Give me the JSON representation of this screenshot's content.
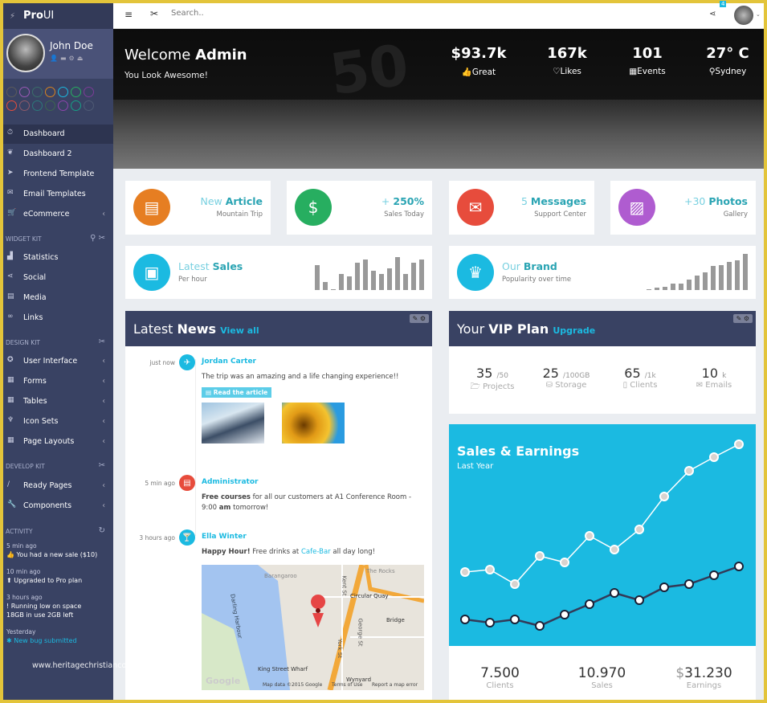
{
  "app": {
    "brand_bold": "Pro",
    "brand_light": "UI"
  },
  "user": {
    "name": "John Doe"
  },
  "theme_colors": [
    "#5b5b5b",
    "#9b59b6",
    "#3a6f6a",
    "#d9831f",
    "#1bbae1",
    "#27ae60",
    "#7d3c98",
    "#e74c3c",
    "#8e5a6a",
    "#2c7a7b",
    "#3d6650",
    "#8e44ad",
    "#16a085",
    "#4f5b75"
  ],
  "sidebar": {
    "main": [
      {
        "label": "Dashboard",
        "icon": "stopwatch-icon",
        "active": true
      },
      {
        "label": "Dashboard 2",
        "icon": "leaf-icon"
      },
      {
        "label": "Frontend Template",
        "icon": "send-icon"
      },
      {
        "label": "Email Templates",
        "icon": "envelope-icon"
      },
      {
        "label": "eCommerce",
        "icon": "cart-icon",
        "submenu": true
      }
    ],
    "widget_kit": {
      "title": "WIDGET KIT",
      "items": [
        {
          "label": "Statistics",
          "icon": "chart-icon"
        },
        {
          "label": "Social",
          "icon": "share-icon"
        },
        {
          "label": "Media",
          "icon": "film-icon"
        },
        {
          "label": "Links",
          "icon": "link-icon"
        }
      ]
    },
    "design_kit": {
      "title": "DESIGN KIT",
      "items": [
        {
          "label": "User Interface",
          "icon": "certificate-icon"
        },
        {
          "label": "Forms",
          "icon": "clipboard-icon"
        },
        {
          "label": "Tables",
          "icon": "table-icon"
        },
        {
          "label": "Icon Sets",
          "icon": "trophy-icon"
        },
        {
          "label": "Page Layouts",
          "icon": "grid-icon"
        }
      ]
    },
    "develop_kit": {
      "title": "DEVELOP KIT",
      "items": [
        {
          "label": "Ready Pages",
          "icon": "brush-icon"
        },
        {
          "label": "Components",
          "icon": "wrench-icon"
        }
      ]
    },
    "activity": {
      "title": "ACTIVITY",
      "items": [
        {
          "time": "5 min ago",
          "text": "You had a new sale ($10)"
        },
        {
          "time": "10 min ago",
          "text": "Upgraded to Pro plan"
        },
        {
          "time": "3 hours ago",
          "text": "Running low on space",
          "text2": "18GB in use 2GB left"
        },
        {
          "time": "Yesterday",
          "text": "New bug submitted",
          "link": true
        }
      ]
    }
  },
  "topbar": {
    "search_placeholder": "Search..",
    "notification_count": "4"
  },
  "hero": {
    "welcome": "Welcome ",
    "name": "Admin",
    "subtitle": "You Look Awesome!",
    "stats": [
      {
        "value": "$93.7k",
        "label": "Great",
        "icon": "thumbs-up-icon"
      },
      {
        "value": "167k",
        "label": "Likes",
        "icon": "heart-icon"
      },
      {
        "value": "101",
        "label": "Events",
        "icon": "calendar-icon"
      },
      {
        "value": "27° C",
        "label": "Sydney",
        "icon": "map-marker-icon"
      }
    ]
  },
  "tiles": [
    {
      "light": "New ",
      "bold": "Article",
      "sub": "Mountain Trip",
      "color": "#e67e22",
      "icon": "file-icon"
    },
    {
      "light": "+ ",
      "bold": "250%",
      "sub": "Sales Today",
      "color": "#27ae60",
      "icon": "dollar-icon"
    },
    {
      "light": "5 ",
      "bold": "Messages",
      "sub": "Support Center",
      "color": "#e74c3c",
      "icon": "envelope-icon"
    },
    {
      "light": "+30 ",
      "bold": "Photos",
      "sub": "Gallery",
      "color": "#af5cd0",
      "icon": "image-icon"
    }
  ],
  "latest_sales": {
    "light": "Latest ",
    "bold": "Sales",
    "sub": "Per hour",
    "bars": [
      9,
      3,
      0.3,
      6,
      5,
      10,
      11,
      7,
      6,
      8,
      12,
      6,
      10,
      11
    ]
  },
  "brand": {
    "light": "Our ",
    "bold": "Brand",
    "sub": "Popularity over time",
    "bars": [
      1,
      2,
      3,
      6,
      6,
      9,
      13,
      16,
      21,
      22,
      25,
      26,
      32
    ]
  },
  "news": {
    "title_light": "Latest ",
    "title_bold": "News",
    "link": "View all",
    "items": [
      {
        "time": "just now",
        "name": "Jordan Carter",
        "text": "The trip was an amazing and a life changing experience!!",
        "button": "Read the article",
        "color": "#1bbae1",
        "icon": "plane-icon"
      },
      {
        "time": "5 min ago",
        "name": "Administrator",
        "bold1": "Free courses",
        "text": " for all our customers at A1 Conference Room - 9:00 ",
        "bold2": "am",
        "text2": " tomorrow!",
        "color": "#e74c3c",
        "icon": "file-icon"
      },
      {
        "time": "3 hours ago",
        "name": "Ella Winter",
        "bold1": "Happy Hour!",
        "text": " Free drinks at ",
        "link": "Cafe-Bar",
        "text2": " all day long!",
        "color": "#1bbae1",
        "icon": "cocktail-icon"
      }
    ],
    "map": {
      "labels": [
        "Barangaroo",
        "The Rocks",
        "Circular Quay",
        "Kent St",
        "George St",
        "York St",
        "Bridge",
        "King Street Wharf",
        "Wynyard",
        "Darling Harbour"
      ],
      "footer": [
        "Map data ©2015 Google",
        "Terms of Use",
        "Report a map error"
      ],
      "logo": "Google"
    }
  },
  "vip": {
    "title_light": "Your ",
    "title_bold": "VIP Plan",
    "link": "Upgrade",
    "stats": [
      {
        "value": "35",
        "unit": "/50",
        "label": "Projects",
        "icon": "folder-icon"
      },
      {
        "value": "25",
        "unit": "/100GB",
        "label": "Storage",
        "icon": "hdd-icon"
      },
      {
        "value": "65",
        "unit": "/1k",
        "label": "Clients",
        "icon": "tablet-icon"
      },
      {
        "value": "10",
        "unit": "k",
        "label": "Emails",
        "icon": "envelope-icon"
      }
    ]
  },
  "chart_data": {
    "type": "line",
    "title": "Sales & Earnings",
    "subtitle": "Last Year",
    "background": "#1bbae1",
    "x": [
      1,
      2,
      3,
      4,
      5,
      6,
      7,
      8,
      9,
      10,
      11,
      12
    ],
    "series": [
      {
        "values": [
          88,
          91,
          73,
          108,
          100,
          133,
          116,
          141,
          182,
          214,
          231,
          247
        ],
        "color": "#ffffff"
      },
      {
        "values": [
          29,
          25,
          29,
          21,
          35,
          48,
          62,
          53,
          69,
          73,
          84,
          95
        ],
        "color": "#333a58"
      }
    ]
  },
  "totals": [
    {
      "value": "7.500",
      "label": "Clients"
    },
    {
      "prefix": "$",
      "value": "10.970",
      "label": "Sales"
    },
    {
      "prefix": "$",
      "value": "31.230",
      "label": "Earnings"
    }
  ],
  "watermark": "www.heritagechristiancollege.com"
}
